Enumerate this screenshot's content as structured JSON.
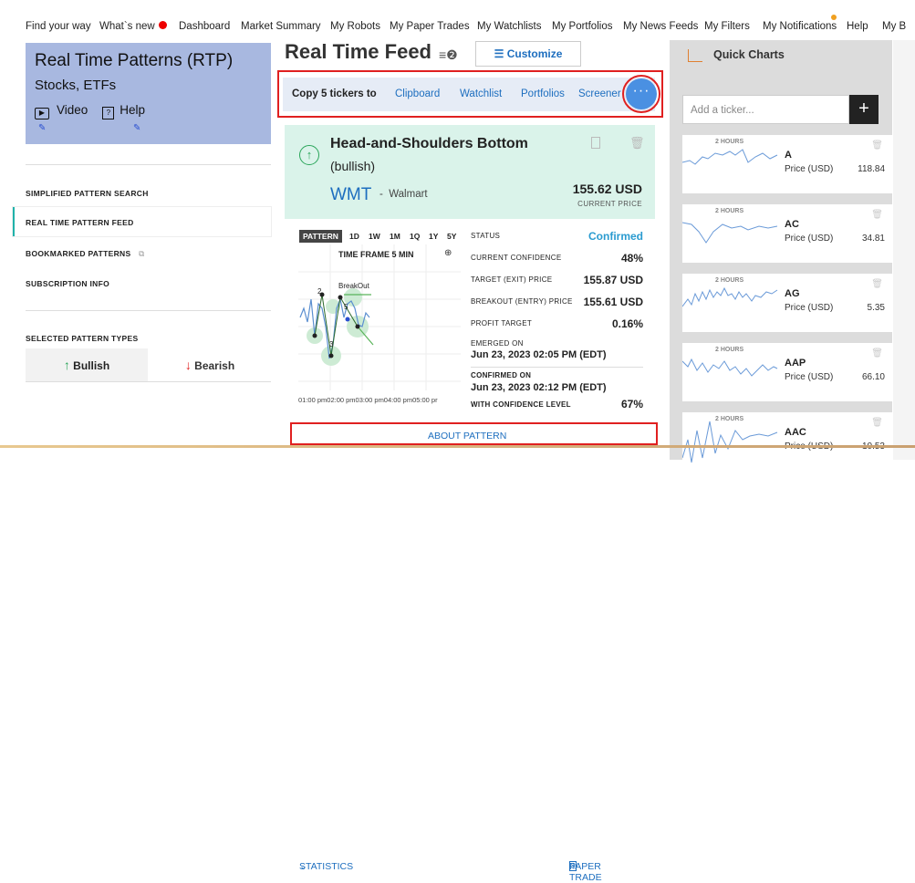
{
  "topnav": [
    "Find your way",
    "What`s new",
    "Dashboard",
    "Market Summary",
    "My Robots",
    "My Paper Trades",
    "My Watchlists",
    "My Portfolios",
    "My News Feeds",
    "My Filters",
    "My Notifications",
    "Help",
    "My B"
  ],
  "left": {
    "title": "Real Time Patterns (RTP)",
    "subtitle": "Stocks, ETFs",
    "video": "Video",
    "help": "Help",
    "menu": [
      "SIMPLIFIED PATTERN SEARCH",
      "REAL TIME PATTERN FEED",
      "BOOKMARKED PATTERNS",
      "SUBSCRIPTION INFO"
    ],
    "selected_types": "SELECTED PATTERN TYPES",
    "bullish": "Bullish",
    "bearish": "Bearish"
  },
  "feed": {
    "title": "Real Time Feed",
    "customize": "Customize",
    "copy_label": "Copy 5 tickers to",
    "copy_links": [
      "Clipboard",
      "Watchlist",
      "Portfolios",
      "Screener"
    ],
    "more": "···"
  },
  "pattern": {
    "name_line1": "Head-and-Shoulders Bottom",
    "name_line2": "(bullish)",
    "ticker": "WMT",
    "dash": "-",
    "company": "Walmart",
    "price": "155.62 USD",
    "price_label": "CURRENT PRICE",
    "timeframes": [
      "PATTERN",
      "1D",
      "1W",
      "1M",
      "1Q",
      "1Y",
      "5Y"
    ],
    "chart_title": "TIME FRAME 5 MIN",
    "chart_breakout": "BreakOut",
    "chart_xaxis": "01:00 pm02:00 pm03:00 pm04:00 pm05:00 pr",
    "stats": [
      {
        "label": "STATUS",
        "value": "Confirmed"
      },
      {
        "label": "CURRENT CONFIDENCE",
        "value": "48%"
      },
      {
        "label": "TARGET (EXIT) PRICE",
        "value": "155.87 USD"
      },
      {
        "label": "BREAKOUT (ENTRY) PRICE",
        "value": "155.61 USD"
      },
      {
        "label": "PROFIT TARGET",
        "value": "0.16%"
      }
    ],
    "emerged_label": "EMERGED ON",
    "emerged_value": "Jun 23, 2023 02:05 PM (EDT)",
    "confirmed_label": "CONFIRMED ON",
    "confirmed_value": "Jun 23, 2023 02:12 PM (EDT)",
    "conf_level_label": "WITH CONFIDENCE LEVEL",
    "conf_level_value": "67%",
    "links": {
      "statistics": "STATISTICS",
      "about": "ABOUT PATTERN",
      "paper": "PAPER TRADE"
    }
  },
  "quick": {
    "title": "Quick Charts",
    "placeholder": "Add a ticker...",
    "add": "+",
    "price_label": "Price (USD)",
    "period": "2 HOURS",
    "rows": [
      {
        "sym": "A",
        "price": "118.84"
      },
      {
        "sym": "AC",
        "price": "34.81"
      },
      {
        "sym": "AG",
        "price": "5.35"
      },
      {
        "sym": "AAP",
        "price": "66.10"
      },
      {
        "sym": "AAC",
        "price": "10.53"
      }
    ]
  },
  "colors": {
    "accent": "#1d6ebf",
    "bull": "#2aa55a",
    "bear": "#e02020",
    "card": "#a8b8e0",
    "patternbg": "#daf3ea"
  }
}
